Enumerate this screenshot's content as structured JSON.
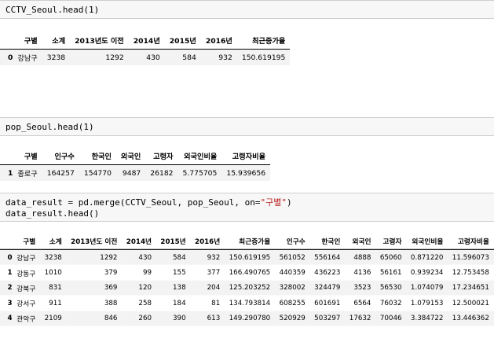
{
  "cells": [
    {
      "code": "CCTV_Seoul.head(1)"
    },
    {
      "code": "pop_Seoul.head(1)"
    },
    {
      "code_line1_a": "data_result = pd.merge(CCTV_Seoul, pop_Seoul, on=",
      "code_line1_str": "\"구별\"",
      "code_line1_b": ")",
      "code_line2": "data_result.head()"
    }
  ],
  "table1": {
    "columns": [
      "구별",
      "소계",
      "2013년도 이전",
      "2014년",
      "2015년",
      "2016년",
      "최근증가율"
    ],
    "rows": [
      {
        "idx": "0",
        "cells": [
          "강남구",
          "3238",
          "1292",
          "430",
          "584",
          "932",
          "150.619195"
        ]
      }
    ]
  },
  "table2": {
    "columns": [
      "구별",
      "인구수",
      "한국인",
      "외국인",
      "고령자",
      "외국인비율",
      "고령자비율"
    ],
    "rows": [
      {
        "idx": "1",
        "cells": [
          "종로구",
          "164257",
          "154770",
          "9487",
          "26182",
          "5.775705",
          "15.939656"
        ]
      }
    ]
  },
  "table3": {
    "columns": [
      "구별",
      "소계",
      "2013년도 이전",
      "2014년",
      "2015년",
      "2016년",
      "최근증가율",
      "인구수",
      "한국인",
      "외국인",
      "고령자",
      "외국인비율",
      "고령자비율"
    ],
    "rows": [
      {
        "idx": "0",
        "cells": [
          "강남구",
          "3238",
          "1292",
          "430",
          "584",
          "932",
          "150.619195",
          "561052",
          "556164",
          "4888",
          "65060",
          "0.871220",
          "11.596073"
        ]
      },
      {
        "idx": "1",
        "cells": [
          "강동구",
          "1010",
          "379",
          "99",
          "155",
          "377",
          "166.490765",
          "440359",
          "436223",
          "4136",
          "56161",
          "0.939234",
          "12.753458"
        ]
      },
      {
        "idx": "2",
        "cells": [
          "강북구",
          "831",
          "369",
          "120",
          "138",
          "204",
          "125.203252",
          "328002",
          "324479",
          "3523",
          "56530",
          "1.074079",
          "17.234651"
        ]
      },
      {
        "idx": "3",
        "cells": [
          "강서구",
          "911",
          "388",
          "258",
          "184",
          "81",
          "134.793814",
          "608255",
          "601691",
          "6564",
          "76032",
          "1.079153",
          "12.500021"
        ]
      },
      {
        "idx": "4",
        "cells": [
          "관악구",
          "2109",
          "846",
          "260",
          "390",
          "613",
          "149.290780",
          "520929",
          "503297",
          "17632",
          "70046",
          "3.384722",
          "13.446362"
        ]
      }
    ]
  }
}
